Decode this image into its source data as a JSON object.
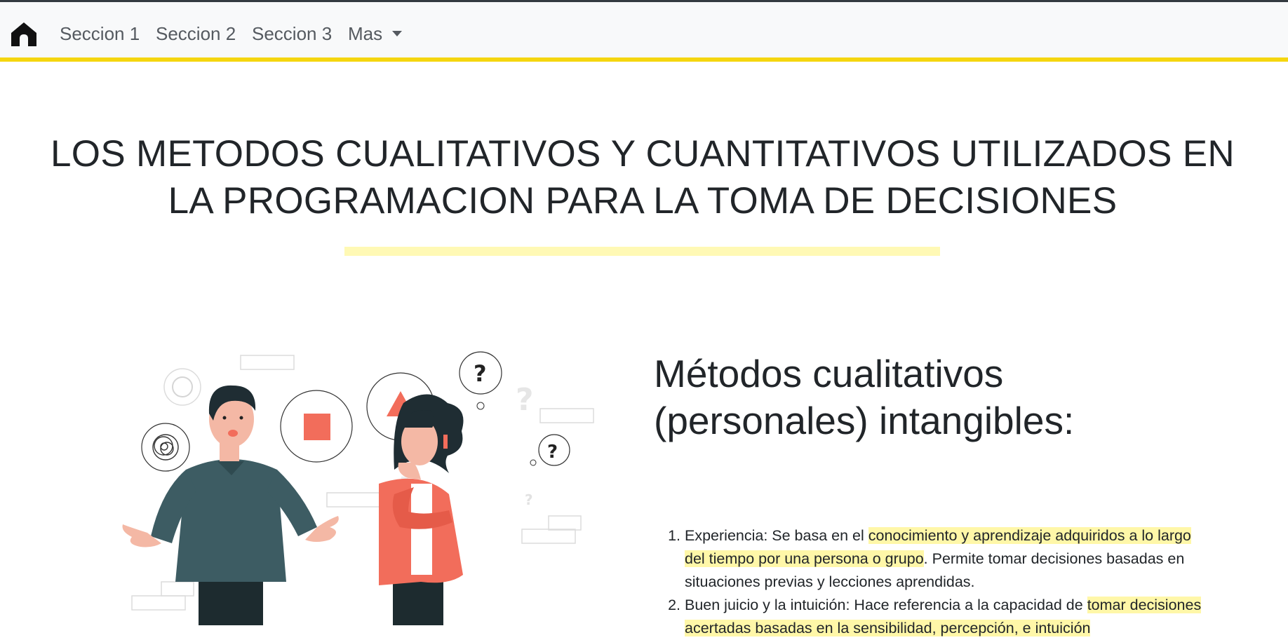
{
  "navbar": {
    "home_icon": "home-icon",
    "links": [
      "Seccion 1",
      "Seccion 2",
      "Seccion 3"
    ],
    "more_label": "Mas",
    "accent_color": "#f5d60f"
  },
  "header": {
    "title_line1": "LOS METODOS CUALITATIVOS Y CUANTITATIVOS UTILIZADOS EN",
    "title_line2": "LA PROGRAMACION PARA LA TOMA DE DECISIONES",
    "underline_color": "#fff9b5"
  },
  "section": {
    "illustration": "two-people-thinking-illustration",
    "heading_line1": "Métodos cualitativos",
    "heading_line2": "(personales) intangibles:",
    "items": [
      {
        "label": "Experiencia: Se basa en el ",
        "highlight": "conocimiento y aprendizaje adquiridos a lo largo del tiempo por una persona o grupo",
        "rest": ". Permite tomar decisiones basadas en situaciones previas y lecciones aprendidas."
      },
      {
        "label": "Buen juicio y la intuición: Hace referencia a la capacidad de ",
        "highlight": "tomar decisiones acertadas basadas en la sensibilidad, percepción, e intuición",
        "rest": ""
      }
    ]
  }
}
